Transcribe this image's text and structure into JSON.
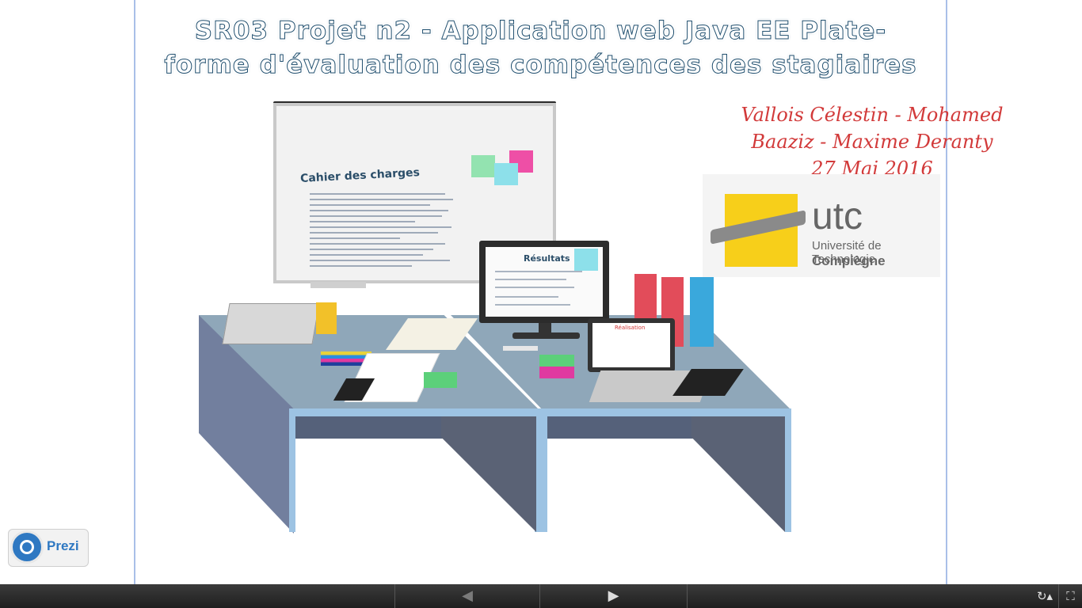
{
  "slide": {
    "title_line1": "SR03 Projet n2 - Application web Java EE Plate-",
    "title_line2": "forme d'évaluation des compétences des stagiaires",
    "authors_line1": "Vallois Célestin - Mohamed",
    "authors_line2": "Baaziz - Maxime Deranty",
    "date": "27 Mai 2016",
    "whiteboard_title": "Cahier des charges",
    "monitor_title": "Résultats",
    "laptop_title": "Réalisation"
  },
  "logo": {
    "utc_text": "utc",
    "utc_sub1": "Université de Technologie",
    "utc_sub2": "Compiègne"
  },
  "prezi": {
    "label": "Prezi"
  },
  "controls": {
    "prev_icon": "arrow-left-icon",
    "next_icon": "arrow-right-icon",
    "autoplay_icon": "autoplay-icon",
    "fullscreen_icon": "fullscreen-icon"
  },
  "colors": {
    "title": "#1f4e6e",
    "authors": "#d23a3a",
    "desk_top": "#8fa7b9",
    "desk_leg": "#55617a",
    "utc_yellow": "#f7cf1a",
    "prezi_blue": "#2e78c2"
  }
}
